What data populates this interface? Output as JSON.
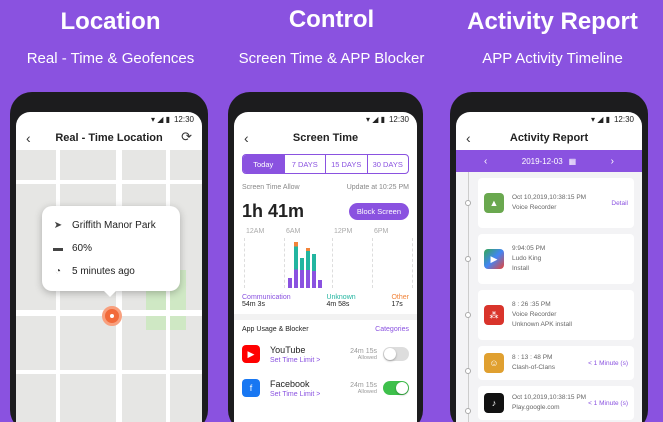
{
  "headers": [
    {
      "title": "Location",
      "subtitle": "Real - Time & Geofences"
    },
    {
      "title": "Control",
      "subtitle": "Screen Time & APP Blocker"
    },
    {
      "title": "Activity Report",
      "subtitle": "APP Activity Timeline"
    }
  ],
  "status_time": "12:30",
  "location": {
    "nav_title": "Real - Time Location",
    "place": "Griffith Manor Park",
    "battery": "60%",
    "updated": "5 minutes ago"
  },
  "screen_time": {
    "nav_title": "Screen Time",
    "tabs": [
      "Today",
      "7 DAYS",
      "15 DAYS",
      "30 DAYS"
    ],
    "allow_label": "Screen Time Allow",
    "update_label": "Update at 10:25 PM",
    "total": "1h 41m",
    "block_button": "Block Screen",
    "chart_ticks": [
      "12AM",
      "6AM",
      "12PM",
      "6PM"
    ],
    "legend": [
      {
        "name": "Communication",
        "value": "54m 3s",
        "color": "#8a52e0"
      },
      {
        "name": "Unknown",
        "value": "4m 58s",
        "color": "#22b5a0"
      },
      {
        "name": "Other",
        "value": "17s",
        "color": "#f2843a"
      }
    ],
    "section_label": "App Usage & Blocker",
    "section_link": "Categories",
    "apps": [
      {
        "name": "YouTube",
        "link": "Set Time Limit >",
        "duration": "24m 15s",
        "status": "Allowed",
        "color": "#ff0000",
        "glyph": "▶"
      },
      {
        "name": "Facebook",
        "link": "Set Time Limit >",
        "duration": "24m 15s",
        "status": "Allowed",
        "color": "#1877f2",
        "glyph": "f"
      }
    ]
  },
  "activity": {
    "nav_title": "Activity Report",
    "date": "2019-12-03",
    "events": [
      {
        "time": "Oct 10,2019,10:38:15 PM",
        "desc": "Voice Recorder",
        "extra": "Detail",
        "color": "#6aa84f",
        "glyph": "▲"
      },
      {
        "time": "9:94:05 PM",
        "desc": "Ludo King",
        "extra2": "Install",
        "color": "#ffffff",
        "glyph": "▶"
      },
      {
        "time": "8 : 26 :35 PM",
        "desc": "Voice Recorder",
        "extra2": "Unknown APK install",
        "color": "#d9342b",
        "glyph": "⁂"
      },
      {
        "time": "8 : 13 : 48 PM",
        "desc": "Clash-of-Clans",
        "extra": "< 1 Minute (s)",
        "color": "#e0a030",
        "glyph": "☺"
      },
      {
        "time": "Oct 10,2019,10:38:15 PM",
        "desc": "Play.google.com",
        "extra": "< 1 Minute (s)",
        "color": "#111111",
        "glyph": "♪"
      }
    ]
  }
}
